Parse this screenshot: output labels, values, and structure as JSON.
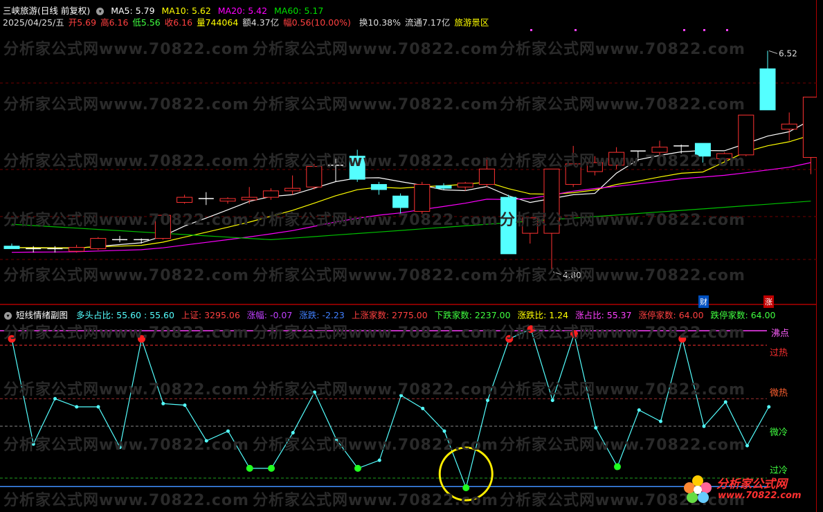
{
  "main_header": {
    "stock": "三峡旅游(日线 前复权)",
    "ma5": "MA5: 5.79",
    "ma10": "MA10: 5.62",
    "ma20": "MA20: 5.42",
    "ma60": "MA60: 5.17",
    "date": "2025/04/25/五",
    "open": "开5.69",
    "high": "高6.16",
    "low": "低5.56",
    "close": "收6.16",
    "volume": "量744064",
    "amount": "额4.37亿",
    "amp": "幅0.56(10.00%)",
    "turnover": "换10.38%",
    "float": "流通7.17亿",
    "sector": "旅游景区"
  },
  "sub_header": {
    "title": "短线情绪副图",
    "bull_ratio": "多头占比: 55.60 : 55.60",
    "index": "上证: 3295.06",
    "chg_pct": "涨幅: -0.07",
    "chg": "涨跌: -2.23",
    "up_count": "上涨家数: 2775.00",
    "down_count": "下跌家数: 2237.00",
    "ratio": "涨跌比: 1.24",
    "up_ratio": "涨占比: 55.37",
    "limit_up": "涨停家数: 64.00",
    "limit_down": "跌停家数: 64.00"
  },
  "price_labels": {
    "high": "6.52",
    "low": "4.80"
  },
  "zone_labels": {
    "boil": "沸点",
    "overheat": "过热",
    "warm": "微热",
    "cool": "微冷",
    "cold": "过冷"
  },
  "tags": {
    "finance": "财",
    "limit": "涨"
  },
  "watermark": "分析家公式网www.70822.com",
  "logo": {
    "name": "分析家公式网",
    "url": "www.70822.com"
  },
  "colors": {
    "up": "#ff3232",
    "down": "#54ffff",
    "ma5": "#ffffff",
    "ma10": "#ffff00",
    "ma20": "#ff00ff",
    "ma60": "#00c000",
    "sentiment": "#54ffff"
  },
  "chart_data": [
    {
      "type": "candlestick",
      "ylim": [
        4.6,
        6.7
      ],
      "candles": [
        {
          "o": 5.0,
          "h": 5.02,
          "l": 4.98,
          "c": 4.98
        },
        {
          "o": 4.98,
          "h": 5.0,
          "l": 4.95,
          "c": 4.98
        },
        {
          "o": 4.97,
          "h": 5.0,
          "l": 4.95,
          "c": 4.98
        },
        {
          "o": 4.96,
          "h": 5.01,
          "l": 4.95,
          "c": 4.99
        },
        {
          "o": 4.98,
          "h": 5.07,
          "l": 4.97,
          "c": 5.06
        },
        {
          "o": 5.05,
          "h": 5.08,
          "l": 5.03,
          "c": 5.05
        },
        {
          "o": 5.04,
          "h": 5.06,
          "l": 5.02,
          "c": 5.05
        },
        {
          "o": 5.06,
          "h": 5.25,
          "l": 5.05,
          "c": 5.24
        },
        {
          "o": 5.34,
          "h": 5.4,
          "l": 5.33,
          "c": 5.38
        },
        {
          "o": 5.37,
          "h": 5.42,
          "l": 5.32,
          "c": 5.37
        },
        {
          "o": 5.35,
          "h": 5.38,
          "l": 5.33,
          "c": 5.37
        },
        {
          "o": 5.36,
          "h": 5.46,
          "l": 5.33,
          "c": 5.38
        },
        {
          "o": 5.38,
          "h": 5.45,
          "l": 5.36,
          "c": 5.43
        },
        {
          "o": 5.43,
          "h": 5.55,
          "l": 5.4,
          "c": 5.45
        },
        {
          "o": 5.46,
          "h": 5.64,
          "l": 5.44,
          "c": 5.62
        },
        {
          "o": 5.63,
          "h": 5.69,
          "l": 5.5,
          "c": 5.63
        },
        {
          "o": 5.7,
          "h": 5.75,
          "l": 5.5,
          "c": 5.52
        },
        {
          "o": 5.48,
          "h": 5.5,
          "l": 5.4,
          "c": 5.44
        },
        {
          "o": 5.39,
          "h": 5.41,
          "l": 5.25,
          "c": 5.3
        },
        {
          "o": 5.27,
          "h": 5.5,
          "l": 5.25,
          "c": 5.48
        },
        {
          "o": 5.47,
          "h": 5.49,
          "l": 5.44,
          "c": 5.45
        },
        {
          "o": 5.46,
          "h": 5.5,
          "l": 5.43,
          "c": 5.49
        },
        {
          "o": 5.48,
          "h": 5.69,
          "l": 5.46,
          "c": 5.6
        },
        {
          "o": 5.38,
          "h": 5.4,
          "l": 4.94,
          "c": 4.94
        },
        {
          "o": 5.1,
          "h": 5.22,
          "l": 5.02,
          "c": 5.22
        },
        {
          "o": 5.1,
          "h": 5.6,
          "l": 4.8,
          "c": 5.6
        },
        {
          "o": 5.48,
          "h": 5.78,
          "l": 5.46,
          "c": 5.64
        },
        {
          "o": 5.58,
          "h": 5.7,
          "l": 5.55,
          "c": 5.65
        },
        {
          "o": 5.63,
          "h": 5.77,
          "l": 5.6,
          "c": 5.73
        },
        {
          "o": 5.73,
          "h": 5.74,
          "l": 5.66,
          "c": 5.74
        },
        {
          "o": 5.73,
          "h": 5.82,
          "l": 5.7,
          "c": 5.77
        },
        {
          "o": 5.77,
          "h": 5.79,
          "l": 5.72,
          "c": 5.78
        },
        {
          "o": 5.8,
          "h": 5.73,
          "l": 5.65,
          "c": 5.7
        },
        {
          "o": 5.68,
          "h": 5.73,
          "l": 5.66,
          "c": 5.72
        },
        {
          "o": 5.71,
          "h": 6.02,
          "l": 5.7,
          "c": 6.02
        },
        {
          "o": 6.38,
          "h": 6.52,
          "l": 6.06,
          "c": 6.06
        },
        {
          "o": 5.91,
          "h": 6.04,
          "l": 5.82,
          "c": 5.95
        },
        {
          "o": 5.69,
          "h": 6.16,
          "l": 5.56,
          "c": 6.16
        }
      ]
    },
    {
      "type": "line",
      "name": "多头占比",
      "values": [
        95,
        30,
        58,
        53,
        53,
        28,
        95,
        55,
        54,
        32,
        38,
        15,
        15,
        37,
        62,
        33,
        15,
        20,
        60,
        52,
        38,
        3,
        57,
        95,
        101,
        57,
        98,
        40,
        16,
        51,
        44,
        95,
        41,
        56,
        29,
        53
      ],
      "ylim": [
        0,
        100
      ],
      "levels": {
        "boil": 100,
        "overheat": 91,
        "warm": 58,
        "cool": 41,
        "cold": 9,
        "base": 5
      }
    }
  ]
}
